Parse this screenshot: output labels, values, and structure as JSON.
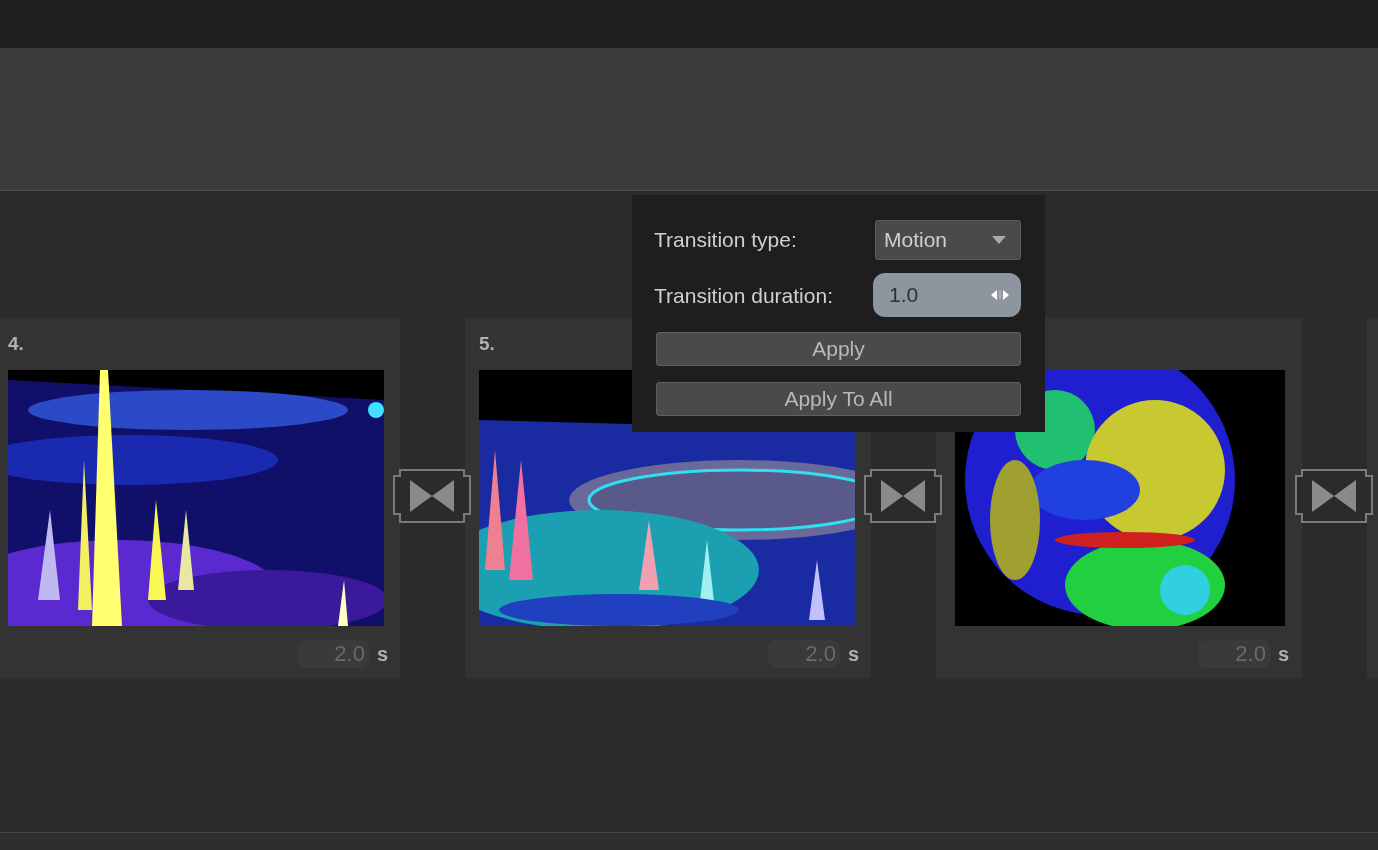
{
  "popup": {
    "rows": [
      {
        "label": "Transition type:",
        "kind": "dropdown",
        "value": "Motion"
      },
      {
        "label": "Transition duration:",
        "kind": "spinbox",
        "value": "1.0"
      }
    ],
    "buttons": [
      "Apply",
      "Apply To All"
    ]
  },
  "slides": [
    {
      "number": "4.",
      "duration": "2.0",
      "unit": "s"
    },
    {
      "number": "5.",
      "duration": "2.0",
      "unit": "s"
    },
    {
      "duration": "2.0",
      "unit": "s"
    }
  ]
}
